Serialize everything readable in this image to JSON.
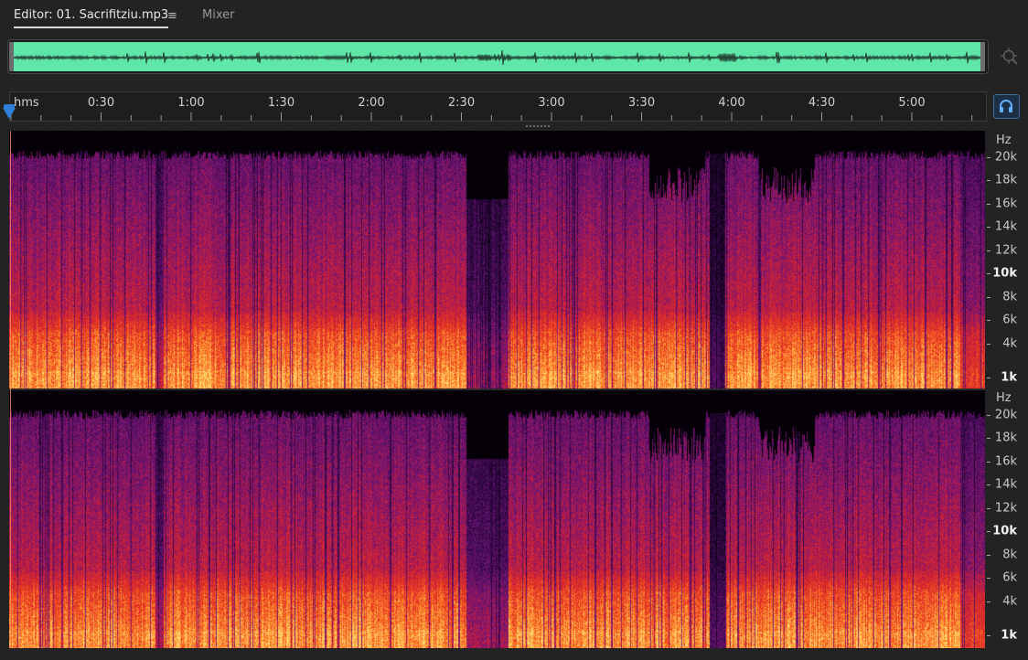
{
  "tabs": {
    "editor_label": "Editor: 01. Sacrifitziu.mp3",
    "menu_glyph": "≡",
    "mixer_label": "Mixer"
  },
  "ruler": {
    "unit": "hms",
    "labels": [
      "0:30",
      "1:00",
      "1:30",
      "2:00",
      "2:30",
      "3:00",
      "3:30",
      "4:00",
      "4:30",
      "5:00"
    ]
  },
  "spectral": {
    "unit_label": "Hz",
    "labels": [
      {
        "text": "20k",
        "bold": false
      },
      {
        "text": "18k",
        "bold": false
      },
      {
        "text": "16k",
        "bold": false
      },
      {
        "text": "14k",
        "bold": false
      },
      {
        "text": "12k",
        "bold": false
      },
      {
        "text": "10k",
        "bold": true
      },
      {
        "text": "8k",
        "bold": false
      },
      {
        "text": "6k",
        "bold": false
      },
      {
        "text": "4k",
        "bold": false
      },
      {
        "text": "1k",
        "bold": true
      }
    ]
  },
  "icons": {
    "zoom": "zoom-to-selection-icon",
    "monitor": "headphones-icon"
  },
  "colors": {
    "overview_waveform": "#5fe6a9",
    "playhead": "#2f7fd9",
    "spectrum_hot": "#ffd86a",
    "spectrum_warm": "#d8262a",
    "spectrum_cool": "#5a1370"
  }
}
